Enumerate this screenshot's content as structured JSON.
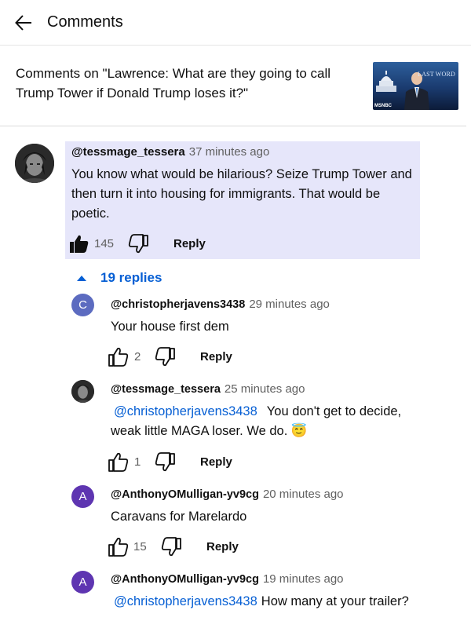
{
  "header": {
    "title": "Comments"
  },
  "video": {
    "text": "Comments on \"Lawrence: What are they going to call Trump Tower if Donald Trump loses it?\"",
    "thumb_brand": "LAST WORD",
    "thumb_network": "MSNBC"
  },
  "main_comment": {
    "handle": "@tessmage_tessera",
    "time": "37 minutes ago",
    "text": "You know what would be hilarious? Seize Trump Tower and then turn it into housing for immigrants. That would be poetic.",
    "likes": "145",
    "reply_label": "Reply"
  },
  "replies_toggle": {
    "label": "19 replies"
  },
  "replies": [
    {
      "avatar_letter": "C",
      "avatar_color": "#5c6bc0",
      "handle": "@christopherjavens3438",
      "time": "29 minutes ago",
      "mention": "",
      "text": "Your house first dem",
      "likes": "2",
      "reply_label": "Reply"
    },
    {
      "avatar_letter": "",
      "avatar_color": "#3a3a3a",
      "handle": "@tessmage_tessera",
      "time": "25 minutes ago",
      "mention": "@christopherjavens3438",
      "text": "You don't get to decide, weak little MAGA loser. We do. 😇",
      "likes": "1",
      "reply_label": "Reply"
    },
    {
      "avatar_letter": "A",
      "avatar_color": "#5e35b1",
      "handle": "@AnthonyOMulligan-yv9cg",
      "time": "20 minutes ago",
      "mention": "",
      "text": "Caravans for Marelardo",
      "likes": "15",
      "reply_label": "Reply"
    },
    {
      "avatar_letter": "A",
      "avatar_color": "#5e35b1",
      "handle": "@AnthonyOMulligan-yv9cg",
      "time": "19 minutes ago",
      "mention": "@christopherjavens3438",
      "text": "How many at your trailer?",
      "likes": "",
      "reply_label": ""
    }
  ],
  "colors": {
    "accent": "#065fd4",
    "highlight": "#e6e6fa",
    "muted": "#606060"
  }
}
